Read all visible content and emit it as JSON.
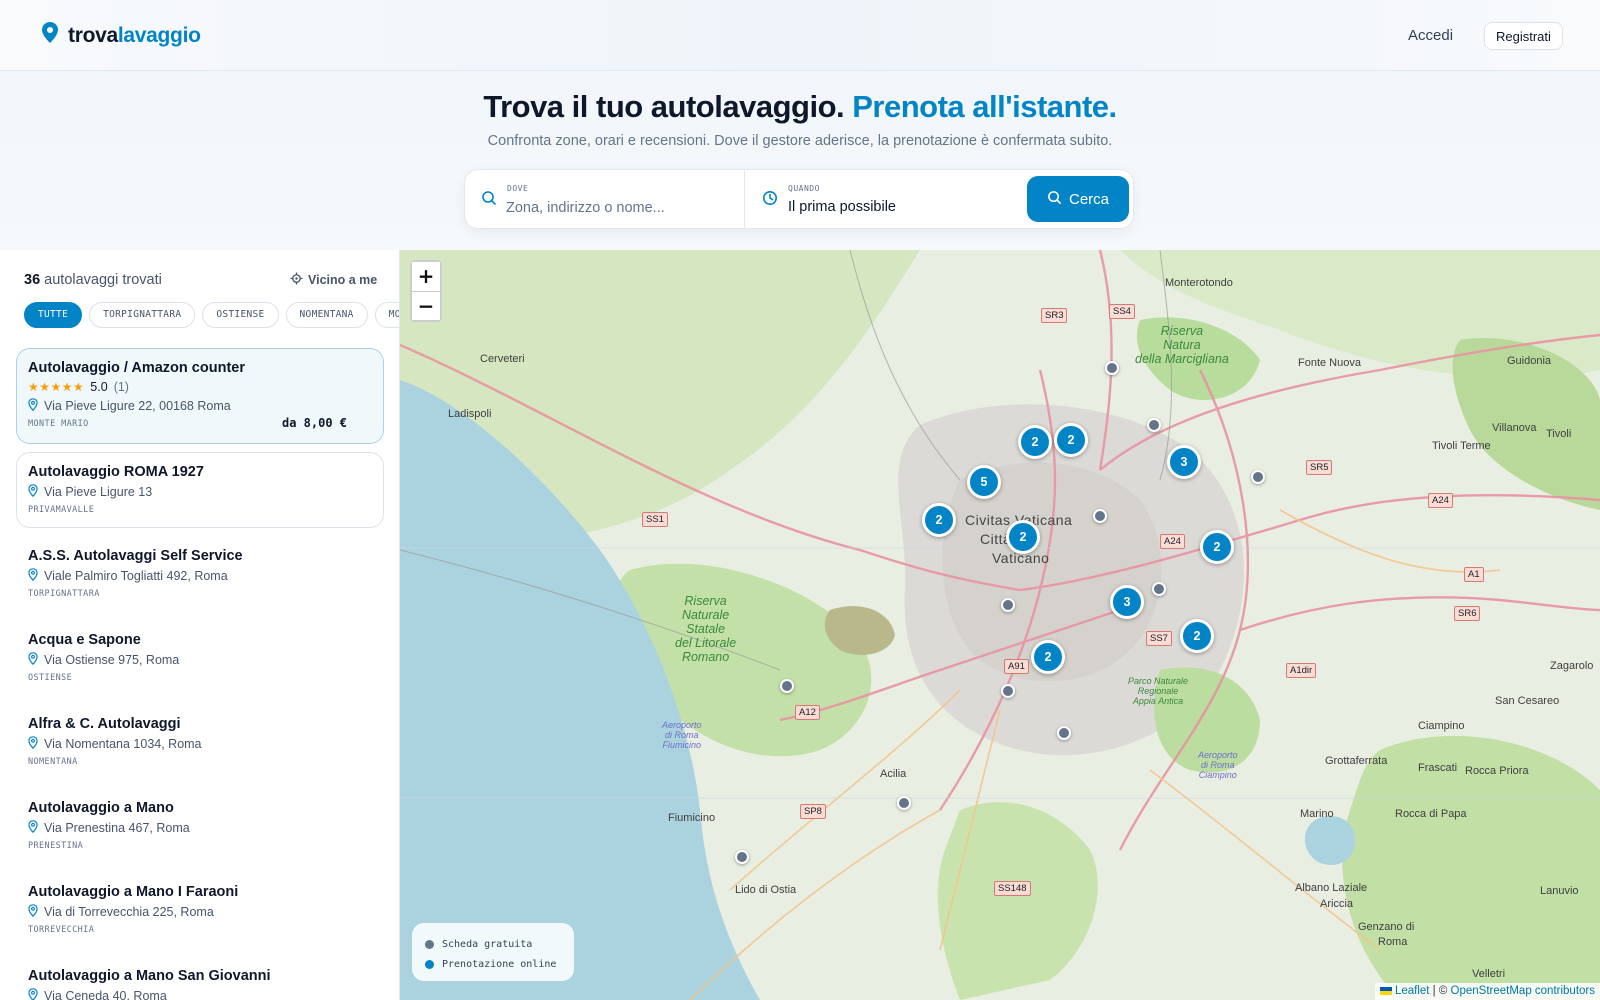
{
  "header": {
    "logo_part1": "trova",
    "logo_part2": "lavaggio",
    "login_label": "Accedi",
    "register_label": "Registrati"
  },
  "hero": {
    "title_main": "Trova il tuo autolavaggio.",
    "title_accent": "Prenota all'istante.",
    "subtitle": "Confronta zone, orari e recensioni. Dove il gestore aderisce, la prenotazione è confermata subito."
  },
  "search": {
    "where_label": "DOVE",
    "where_placeholder": "Zona, indirizzo o nome...",
    "when_label": "QUANDO",
    "when_value": "Il prima possibile",
    "button_label": "Cerca"
  },
  "results": {
    "count": "36",
    "count_suffix": "autolavaggi trovati",
    "near_me_label": "Vicino a me",
    "chips": [
      "TUTTE",
      "TORPIGNATTARA",
      "OSTIENSE",
      "NOMENTANA",
      "MONTE MARIO"
    ],
    "items": [
      {
        "name": "Autolavaggio / Amazon counter",
        "rating": "5.0",
        "reviews": "(1)",
        "address": "Via Pieve Ligure 22, 00168 Roma",
        "district": "MONTE MARIO",
        "price": "da 8,00 €"
      },
      {
        "name": "Autolavaggio ROMA 1927",
        "address": "Via Pieve Ligure 13",
        "district": "PRIVAMAVALLE"
      },
      {
        "name": "A.S.S. Autolavaggi Self Service",
        "address": "Viale Palmiro Togliatti 492, Roma",
        "district": "TORPIGNATTARA"
      },
      {
        "name": "Acqua e Sapone",
        "address": "Via Ostiense 975, Roma",
        "district": "OSTIENSE"
      },
      {
        "name": "Alfra & C. Autolavaggi",
        "address": "Via Nomentana 1034, Roma",
        "district": "NOMENTANA"
      },
      {
        "name": "Autolavaggio a Mano",
        "address": "Via Prenestina 467, Roma",
        "district": "PRENESTINA"
      },
      {
        "name": "Autolavaggio a Mano I Faraoni",
        "address": "Via di Torrevecchia 225, Roma",
        "district": "TORREVECCHIA"
      },
      {
        "name": "Autolavaggio a Mano San Giovanni",
        "address": "Via Ceneda 40, Roma",
        "district": ""
      }
    ]
  },
  "map": {
    "zoom_in": "+",
    "zoom_out": "−",
    "legend": {
      "free": "Scheda gratuita",
      "online": "Prenotazione online"
    },
    "attribution": {
      "leaflet": "Leaflet",
      "sep": "| ©",
      "osm": "OpenStreetMap contributors"
    },
    "clusters": [
      "2",
      "2",
      "3",
      "5",
      "2",
      "2",
      "2",
      "3",
      "2",
      "2"
    ],
    "labels": {
      "monterotondo": "Monterotondo",
      "cerveteri": "Cerveteri",
      "ladispoli": "Ladispoli",
      "fonte_nuova": "Fonte Nuova",
      "guidonia": "Guidonia",
      "villanova": "Villanova",
      "tivoli_terme": "Tivoli Terme",
      "tivoli": "Tivoli",
      "civitas": "Civitas Vaticana",
      "citta": "Città del",
      "vaticano": "Vaticano",
      "fiumicino": "Fiumicino",
      "acilia": "Acilia",
      "lido": "Lido di Ostia",
      "ciampino": "Ciampino",
      "frascati": "Frascati",
      "grottaferrata": "Grottaferrata",
      "rocca_priora": "Rocca Priora",
      "marino": "Marino",
      "rocca_papa": "Rocca di Papa",
      "albano": "Albano Laziale",
      "ariccia": "Ariccia",
      "genzano": "Genzano di",
      "roma": "Roma",
      "lanuvio": "Lanuvio",
      "velletri": "Velletri",
      "zagarolo": "Zagarolo",
      "san_cesareo": "San Cesareo",
      "riserva_marcigliana": "Riserva\nNatura\ndella Marcigliana",
      "riserva_litorale": "Riserva\nNaturale\nStatale\ndel Litorale\nRomano",
      "appia": "Parco Naturale\nRegionale\nAppia Antica",
      "aeroporto_fiumicino": "Aeroporto\ndi Roma\nFiumicino",
      "aeroporto_ciampino": "Aeroporto\ndi Roma\nCiampino"
    },
    "shields": {
      "sr3": "SR3",
      "ss4": "SS4",
      "sr5": "SR5",
      "ss1": "SS1",
      "a24a": "A24",
      "a24b": "A24",
      "a1": "A1",
      "sr6": "SR6",
      "ss7": "SS7",
      "a91": "A91",
      "a12": "A12",
      "a1dir": "A1dir",
      "sp8": "SP8",
      "ss148": "SS148"
    }
  },
  "colors": {
    "accent": "#0284c7",
    "pin_free": "#64748b",
    "water": "#aad3df",
    "park": "#c6e4b0"
  }
}
